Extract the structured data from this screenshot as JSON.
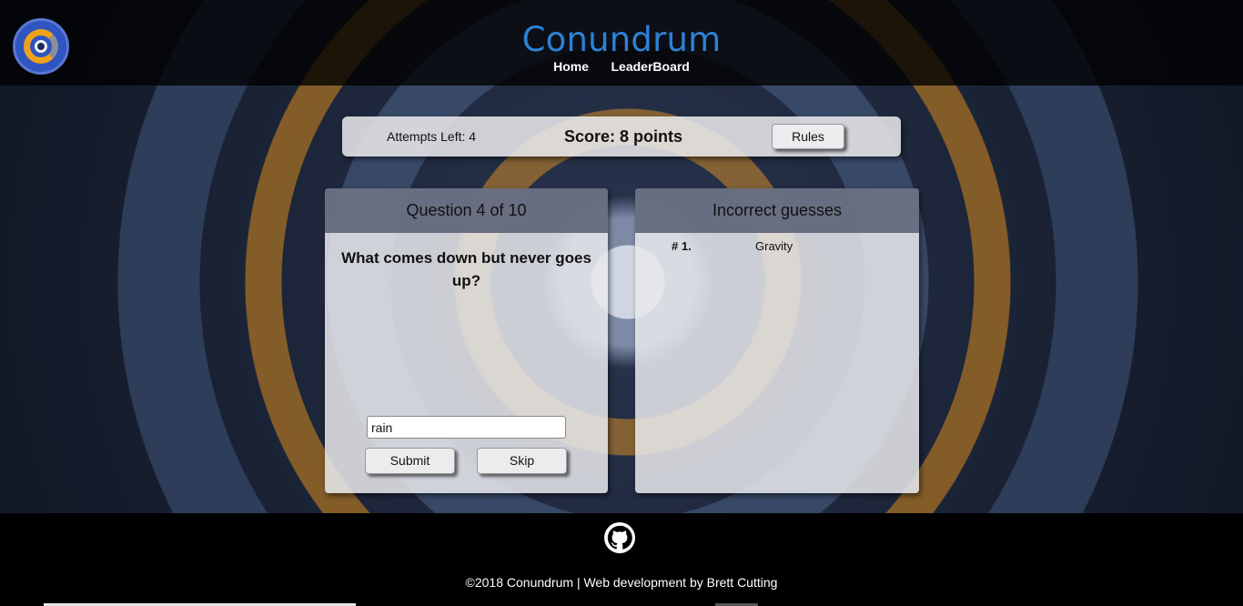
{
  "header": {
    "title": "Conundrum",
    "nav": [
      {
        "label": "Home"
      },
      {
        "label": "LeaderBoard"
      }
    ]
  },
  "status": {
    "attempts_label": "Attempts Left:",
    "attempts_value": "4",
    "score_text": "Score: 8 points",
    "rules_label": "Rules"
  },
  "question_panel": {
    "heading": "Question 4 of 10",
    "question": "What comes down but never goes up?",
    "answer_value": "rain",
    "submit_label": "Submit",
    "skip_label": "Skip"
  },
  "guesses_panel": {
    "heading": "Incorrect guesses",
    "items": [
      {
        "number": "# 1.",
        "guess": "Gravity"
      }
    ]
  },
  "footer": {
    "credits": "©2018 Conundrum | Web development by Brett Cutting",
    "icon": "github-icon"
  },
  "colors": {
    "title_blue": "#2d82d6",
    "panel_header": "#60667a"
  }
}
